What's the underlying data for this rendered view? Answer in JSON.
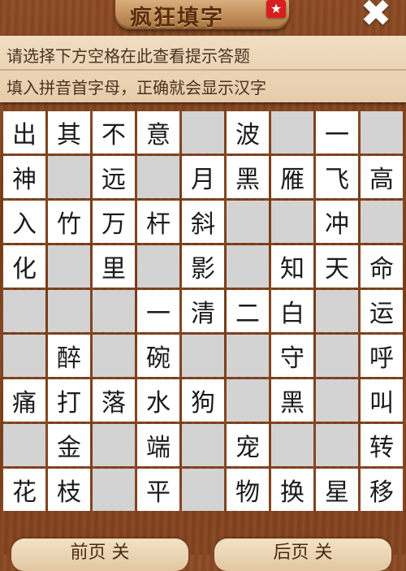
{
  "header": {
    "title": "疯狂填字",
    "badge_icon": "ribbon-icon",
    "close_icon": "close-icon",
    "close_symbol": "✖"
  },
  "hint": {
    "line1": "请选择下方空格在此查看提示答题",
    "line2": "填入拼音首字母，正确就会显示汉字"
  },
  "grid": {
    "rows": [
      [
        "出",
        "其",
        "不",
        "意",
        "",
        "波",
        "",
        "一",
        ""
      ],
      [
        "神",
        "",
        "远",
        "",
        "月",
        "黑",
        "雁",
        "飞",
        "高"
      ],
      [
        "入",
        "竹",
        "万",
        "杆",
        "斜",
        "",
        "",
        "冲",
        ""
      ],
      [
        "化",
        "",
        "里",
        "",
        "影",
        "",
        "知",
        "天",
        "命"
      ],
      [
        "",
        "",
        "",
        "一",
        "清",
        "二",
        "白",
        "",
        "运"
      ],
      [
        "",
        "醉",
        "",
        "碗",
        "",
        "",
        "守",
        "",
        "呼"
      ],
      [
        "痛",
        "打",
        "落",
        "水",
        "狗",
        "",
        "黑",
        "",
        "叫"
      ],
      [
        "",
        "金",
        "",
        "端",
        "",
        "宠",
        "",
        "",
        "转"
      ],
      [
        "花",
        "枝",
        "",
        "平",
        "",
        "物",
        "换",
        "星",
        "移"
      ]
    ]
  },
  "footer": {
    "prev_label": "前页 关",
    "next_label": "后页 关"
  },
  "colors": {
    "background": "#7a3d19",
    "hint_panel": "#efdcc0",
    "filled_cell": "#ffffff",
    "blank_cell": "#d3d3d3",
    "badge": "#d81e1e"
  }
}
